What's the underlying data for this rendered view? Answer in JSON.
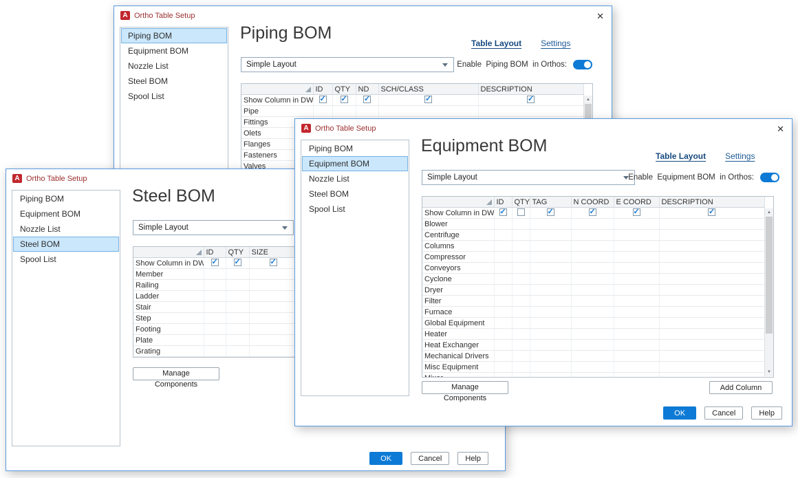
{
  "app": {
    "window_title": "Ortho Table Setup",
    "app_badge_letter": "A",
    "close_glyph": "✕"
  },
  "shared": {
    "sidebar_items": [
      "Piping BOM",
      "Equipment BOM",
      "Nozzle List",
      "Steel BOM",
      "Spool List"
    ],
    "layout_dropdown_value": "Simple Layout",
    "show_column_row_label": "Show Column in DWG",
    "tab_table_layout": "Table Layout",
    "tab_settings": "Settings",
    "manage_components_label": "Manage Components",
    "add_column_label": "Add Column",
    "ok_label": "OK",
    "cancel_label": "Cancel",
    "help_label": "Help",
    "scroll_up_glyph": "▲",
    "scroll_down_glyph": "▼"
  },
  "colors": {
    "accent_blue": "#0d7ad6",
    "selection_blue": "#cbe7fb",
    "checkbox_check_blue": "#1478d1",
    "title_text_red": "#9c2f2f",
    "logo_red": "#c1272d",
    "window_border_blue": "#5a9ade"
  },
  "windows": {
    "piping": {
      "heading": "Piping BOM",
      "selected_sidebar": "Piping BOM",
      "enable_label": "Enable  Piping BOM  in Orthos:",
      "toggle_on": true,
      "columns": [
        "ID",
        "QTY",
        "ND",
        "SCH/CLASS",
        "DESCRIPTION"
      ],
      "show_checks": [
        true,
        true,
        true,
        true,
        true
      ],
      "rows": [
        "Pipe",
        "Fittings",
        "Olets",
        "Flanges",
        "Fasteners",
        "Valves"
      ]
    },
    "steel": {
      "heading": "Steel BOM",
      "selected_sidebar": "Steel BOM",
      "columns": [
        "ID",
        "QTY",
        "SIZE"
      ],
      "show_checks": [
        true,
        true,
        true
      ],
      "rows": [
        "Member",
        "Railing",
        "Ladder",
        "Stair",
        "Step",
        "Footing",
        "Plate",
        "Grating"
      ]
    },
    "equipment": {
      "heading": "Equipment BOM",
      "selected_sidebar": "Equipment BOM",
      "enable_label": "Enable  Equipment BOM  in Orthos:",
      "toggle_on": true,
      "columns": [
        "ID",
        "QTY",
        "TAG",
        "N COORD",
        "E COORD",
        "DESCRIPTION"
      ],
      "show_checks": [
        true,
        false,
        true,
        true,
        true,
        true
      ],
      "rows": [
        "Blower",
        "Centrifuge",
        "Columns",
        "Compressor",
        "Conveyors",
        "Cyclone",
        "Dryer",
        "Filter",
        "Furnace",
        "Global Equipment",
        "Heater",
        "Heat Exchanger",
        "Mechanical Drivers",
        "Misc Equipment",
        "Mixer"
      ]
    }
  }
}
